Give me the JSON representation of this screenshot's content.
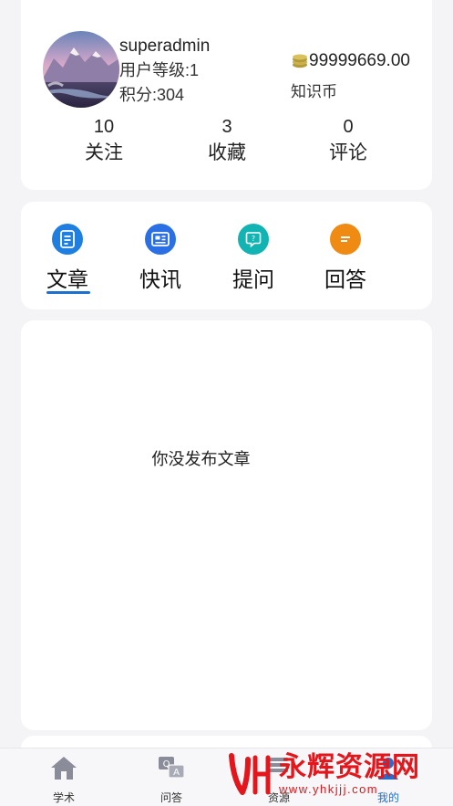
{
  "profile": {
    "username": "superadmin",
    "level_text": "用户等级:1",
    "points_text": "积分:304",
    "coin_amount": "99999669.00",
    "coin_label": "知识币",
    "coin_icon": "coin-stack-icon",
    "avatar_icon": "mountain-landscape-avatar"
  },
  "stats": [
    {
      "value": "10",
      "label": "关注"
    },
    {
      "value": "3",
      "label": "收藏"
    },
    {
      "value": "0",
      "label": "评论"
    }
  ],
  "tabs": [
    {
      "label": "文章",
      "icon": "document-icon",
      "color": "#1f7fe0",
      "active": true
    },
    {
      "label": "快讯",
      "icon": "news-icon",
      "color": "#2a6fe3",
      "active": false
    },
    {
      "label": "提问",
      "icon": "question-bubble-icon",
      "color": "#12b3b3",
      "active": false
    },
    {
      "label": "回答",
      "icon": "answer-bubble-icon",
      "color": "#ef8a12",
      "active": false
    }
  ],
  "content": {
    "empty_message": "你没发布文章"
  },
  "bottom_nav": [
    {
      "label": "学术",
      "icon": "home-icon",
      "active": false
    },
    {
      "label": "问答",
      "icon": "qa-icon",
      "active": false
    },
    {
      "label": "资源",
      "icon": "resource-icon",
      "active": false
    },
    {
      "label": "我的",
      "icon": "user-icon",
      "active": true
    }
  ],
  "watermark": {
    "text": "永辉资源网",
    "url": "www.yhkjjj.com"
  },
  "colors": {
    "accent": "#1f6fd0",
    "background": "#f4f4f6",
    "watermark": "#e4161b"
  }
}
